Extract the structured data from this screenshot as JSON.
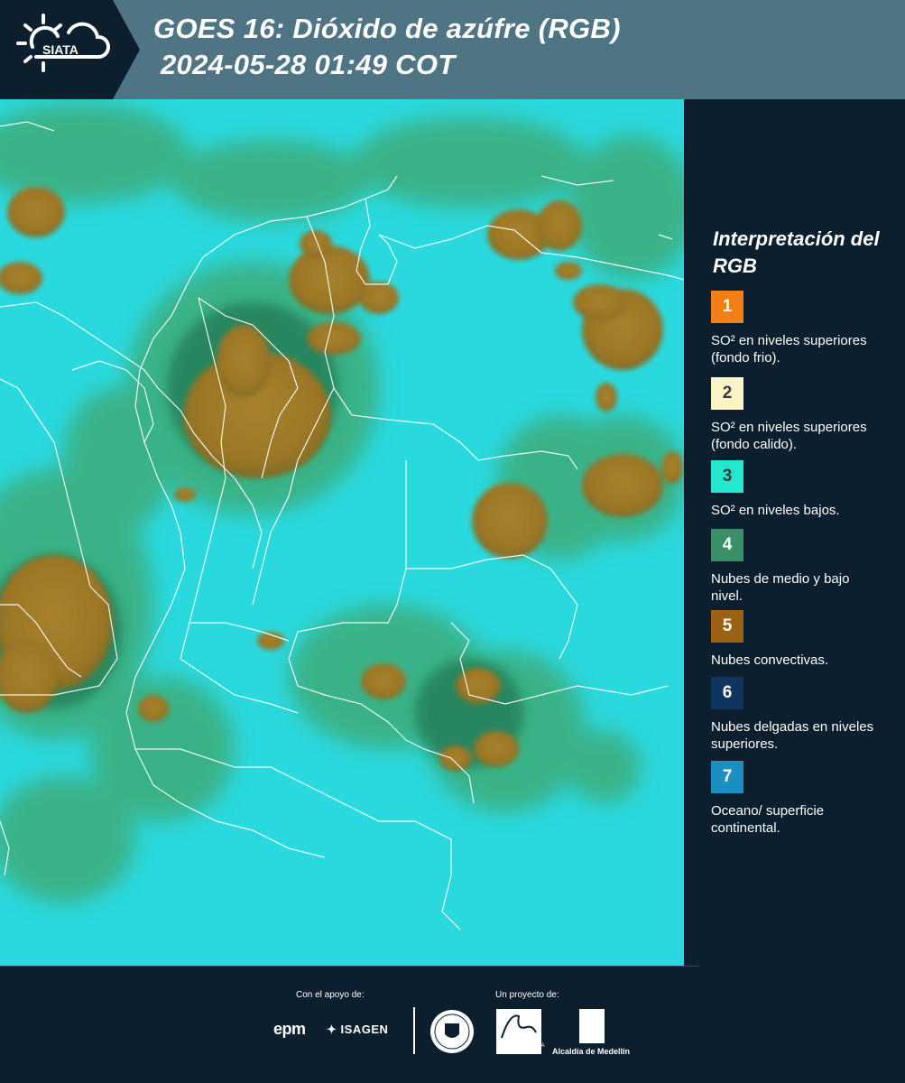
{
  "header": {
    "logo_text": "SIATA",
    "title_line1": "GOES 16: Dióxido de azúfre (RGB)",
    "title_line2": "2024-05-28 01:49 COT",
    "background_color": "#4f7584"
  },
  "legend": {
    "title": "Interpretación del RGB",
    "items": [
      {
        "number": "1",
        "label": "SO² en niveles superiores (fondo frio).",
        "color": "#f47f16"
      },
      {
        "number": "2",
        "label": "SO² en niveles superiores (fondo calido).",
        "color": "#fbf3c6"
      },
      {
        "number": "3",
        "label": "SO² en niveles bajos.",
        "color": "#21e8cf"
      },
      {
        "number": "4",
        "label": "Nubes de medio y bajo nivel.",
        "color": "#3a9066"
      },
      {
        "number": "5",
        "label": "Nubes convectivas.",
        "color": "#9a6113"
      },
      {
        "number": "6",
        "label": "Nubes delgadas en niveles superiores.",
        "color": "#0e3560"
      },
      {
        "number": "7",
        "label": "Oceano/ superficie continental.",
        "color": "#1b8fc2"
      }
    ]
  },
  "footer": {
    "support_label": "Con el apoyo de:",
    "project_label": "Un proyecto de:",
    "sponsor_epm": "epm",
    "sponsor_isagen": "ISAGEN",
    "area_logo_text": "METROPOLITANA Valle de Aburrá",
    "alcaldia_text": "Alcaldía de Medellín"
  },
  "map": {
    "background_color": "#27dce0",
    "convective_color": "#9b7a26",
    "midlevel_color": "#3ea36b"
  }
}
